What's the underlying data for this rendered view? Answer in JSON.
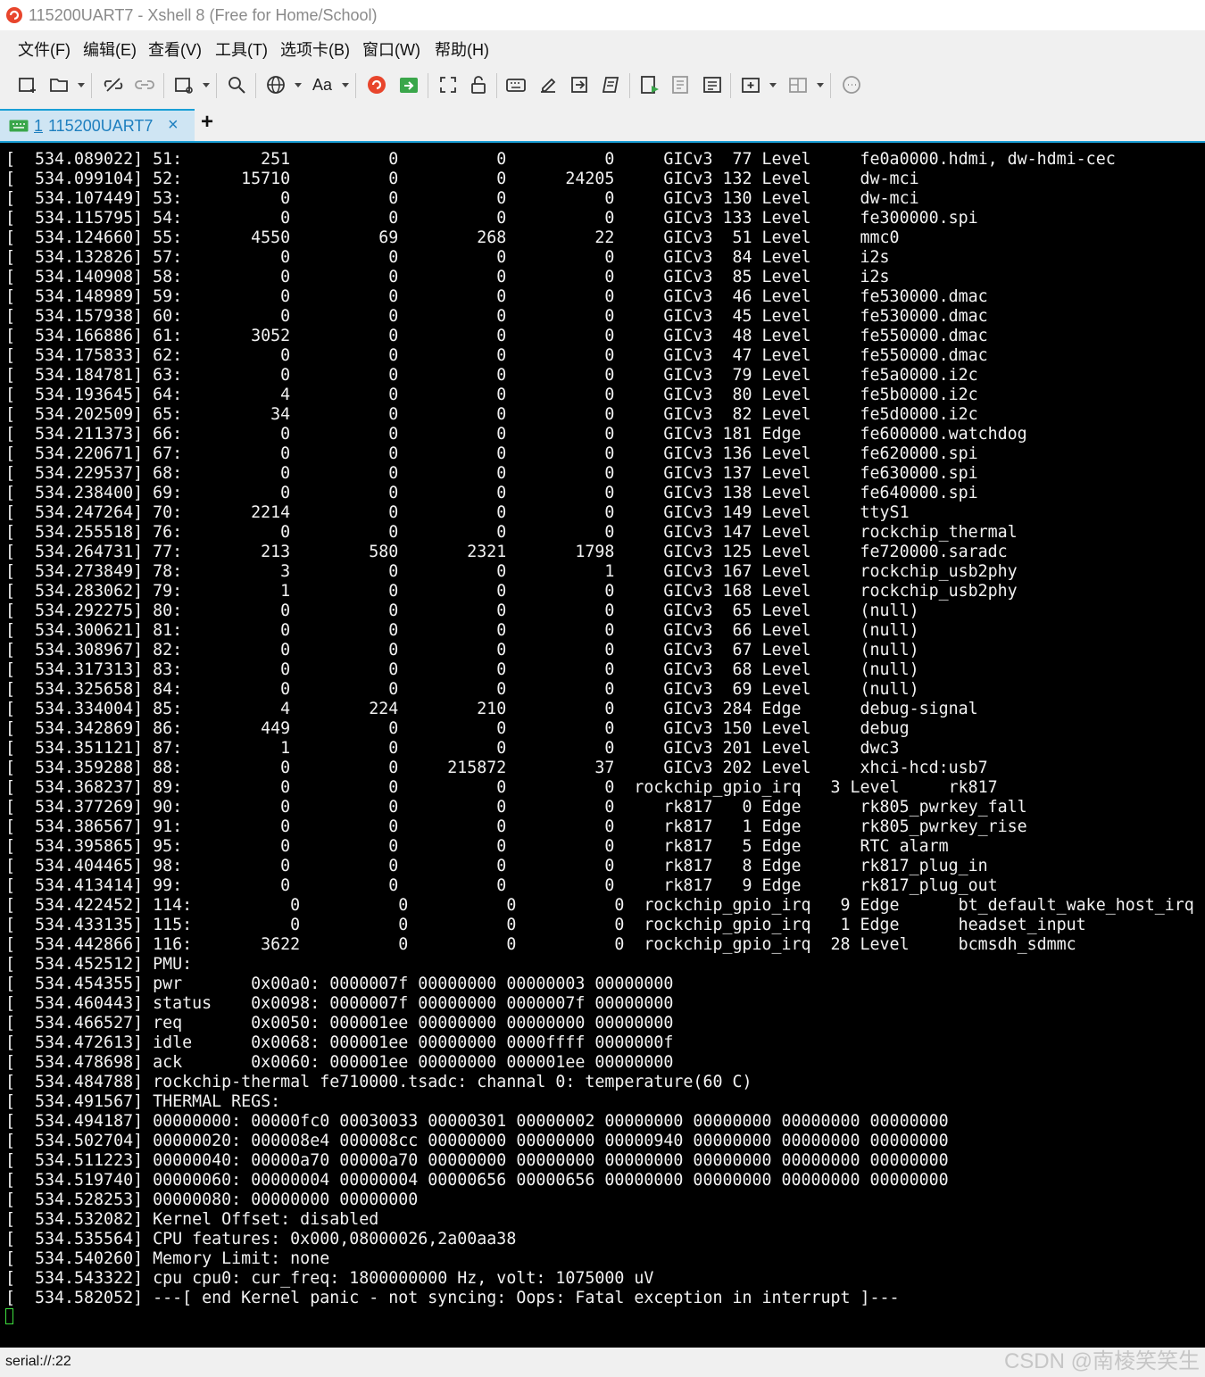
{
  "window": {
    "title": "115200UART7 - Xshell 8 (Free for Home/School)"
  },
  "menu": [
    "文件(F)",
    "编辑(E)",
    "查看(V)",
    "工具(T)",
    "选项卡(B)",
    "窗口(W)",
    "帮助(H)"
  ],
  "toolbar": {
    "font_button_label": "Aa"
  },
  "tab": {
    "number": "1",
    "label": "115200UART7",
    "close_glyph": "×",
    "add_glyph": "+"
  },
  "terminal": {
    "lines": [
      "[  534.089022] 51:        251          0          0          0     GICv3  77 Level     fe0a0000.hdmi, dw-hdmi-cec",
      "[  534.099104] 52:      15710          0          0      24205     GICv3 132 Level     dw-mci",
      "[  534.107449] 53:          0          0          0          0     GICv3 130 Level     dw-mci",
      "[  534.115795] 54:          0          0          0          0     GICv3 133 Level     fe300000.spi",
      "[  534.124660] 55:       4550         69        268         22     GICv3  51 Level     mmc0",
      "[  534.132826] 57:          0          0          0          0     GICv3  84 Level     i2s",
      "[  534.140908] 58:          0          0          0          0     GICv3  85 Level     i2s",
      "[  534.148989] 59:          0          0          0          0     GICv3  46 Level     fe530000.dmac",
      "[  534.157938] 60:          0          0          0          0     GICv3  45 Level     fe530000.dmac",
      "[  534.166886] 61:       3052          0          0          0     GICv3  48 Level     fe550000.dmac",
      "[  534.175833] 62:          0          0          0          0     GICv3  47 Level     fe550000.dmac",
      "[  534.184781] 63:          0          0          0          0     GICv3  79 Level     fe5a0000.i2c",
      "[  534.193645] 64:          4          0          0          0     GICv3  80 Level     fe5b0000.i2c",
      "[  534.202509] 65:         34          0          0          0     GICv3  82 Level     fe5d0000.i2c",
      "[  534.211373] 66:          0          0          0          0     GICv3 181 Edge      fe600000.watchdog",
      "[  534.220671] 67:          0          0          0          0     GICv3 136 Level     fe620000.spi",
      "[  534.229537] 68:          0          0          0          0     GICv3 137 Level     fe630000.spi",
      "[  534.238400] 69:          0          0          0          0     GICv3 138 Level     fe640000.spi",
      "[  534.247264] 70:       2214          0          0          0     GICv3 149 Level     ttyS1",
      "[  534.255518] 76:          0          0          0          0     GICv3 147 Level     rockchip_thermal",
      "[  534.264731] 77:        213        580       2321       1798     GICv3 125 Level     fe720000.saradc",
      "[  534.273849] 78:          3          0          0          1     GICv3 167 Level     rockchip_usb2phy",
      "[  534.283062] 79:          1          0          0          0     GICv3 168 Level     rockchip_usb2phy",
      "[  534.292275] 80:          0          0          0          0     GICv3  65 Level     (null)",
      "[  534.300621] 81:          0          0          0          0     GICv3  66 Level     (null)",
      "[  534.308967] 82:          0          0          0          0     GICv3  67 Level     (null)",
      "[  534.317313] 83:          0          0          0          0     GICv3  68 Level     (null)",
      "[  534.325658] 84:          0          0          0          0     GICv3  69 Level     (null)",
      "[  534.334004] 85:          4        224        210          0     GICv3 284 Edge      debug-signal",
      "[  534.342869] 86:        449          0          0          0     GICv3 150 Level     debug",
      "[  534.351121] 87:          1          0          0          0     GICv3 201 Level     dwc3",
      "[  534.359288] 88:          0          0     215872         37     GICv3 202 Level     xhci-hcd:usb7",
      "[  534.368237] 89:          0          0          0          0  rockchip_gpio_irq   3 Level     rk817",
      "[  534.377269] 90:          0          0          0          0     rk817   0 Edge      rk805_pwrkey_fall",
      "[  534.386567] 91:          0          0          0          0     rk817   1 Edge      rk805_pwrkey_rise",
      "[  534.395865] 95:          0          0          0          0     rk817   5 Edge      RTC alarm",
      "[  534.404465] 98:          0          0          0          0     rk817   8 Edge      rk817_plug_in",
      "[  534.413414] 99:          0          0          0          0     rk817   9 Edge      rk817_plug_out",
      "[  534.422452] 114:          0          0          0          0  rockchip_gpio_irq   9 Edge      bt_default_wake_host_irq",
      "[  534.433135] 115:          0          0          0          0  rockchip_gpio_irq   1 Edge      headset_input",
      "[  534.442866] 116:       3622          0          0          0  rockchip_gpio_irq  28 Level     bcmsdh_sdmmc",
      "[  534.452512] PMU:",
      "[  534.454355] pwr       0x00a0: 0000007f 00000000 00000003 00000000",
      "[  534.460443] status    0x0098: 0000007f 00000000 0000007f 00000000",
      "[  534.466527] req       0x0050: 000001ee 00000000 00000000 00000000",
      "[  534.472613] idle      0x0068: 000001ee 00000000 0000ffff 0000000f",
      "[  534.478698] ack       0x0060: 000001ee 00000000 000001ee 00000000",
      "[  534.484788] rockchip-thermal fe710000.tsadc: channal 0: temperature(60 C)",
      "[  534.491567] THERMAL REGS:",
      "[  534.494187] 00000000: 00000fc0 00030033 00000301 00000002 00000000 00000000 00000000 00000000",
      "[  534.502704] 00000020: 000008e4 000008cc 00000000 00000000 00000940 00000000 00000000 00000000",
      "[  534.511223] 00000040: 00000a70 00000a70 00000000 00000000 00000000 00000000 00000000 00000000",
      "[  534.519740] 00000060: 00000004 00000004 00000656 00000656 00000000 00000000 00000000 00000000",
      "[  534.528253] 00000080: 00000000 00000000",
      "[  534.532082] Kernel Offset: disabled",
      "[  534.535564] CPU features: 0x000,08000026,2a00aa38",
      "[  534.540260] Memory Limit: none",
      "[  534.543322] cpu cpu0: cur_freq: 1800000000 Hz, volt: 1075000 uV",
      "[  534.582052] ---[ end Kernel panic - not syncing: Oops: Fatal exception in interrupt ]---"
    ]
  },
  "status": {
    "connection": "serial://:22"
  },
  "watermark": "CSDN @南棱笑笑生",
  "colors": {
    "terminal_bg": "#000000",
    "terminal_fg": "#f2f2f2",
    "cursor": "#3ee03e",
    "tab_accent": "#1a9fd6",
    "app_icon": "#e8452c"
  }
}
